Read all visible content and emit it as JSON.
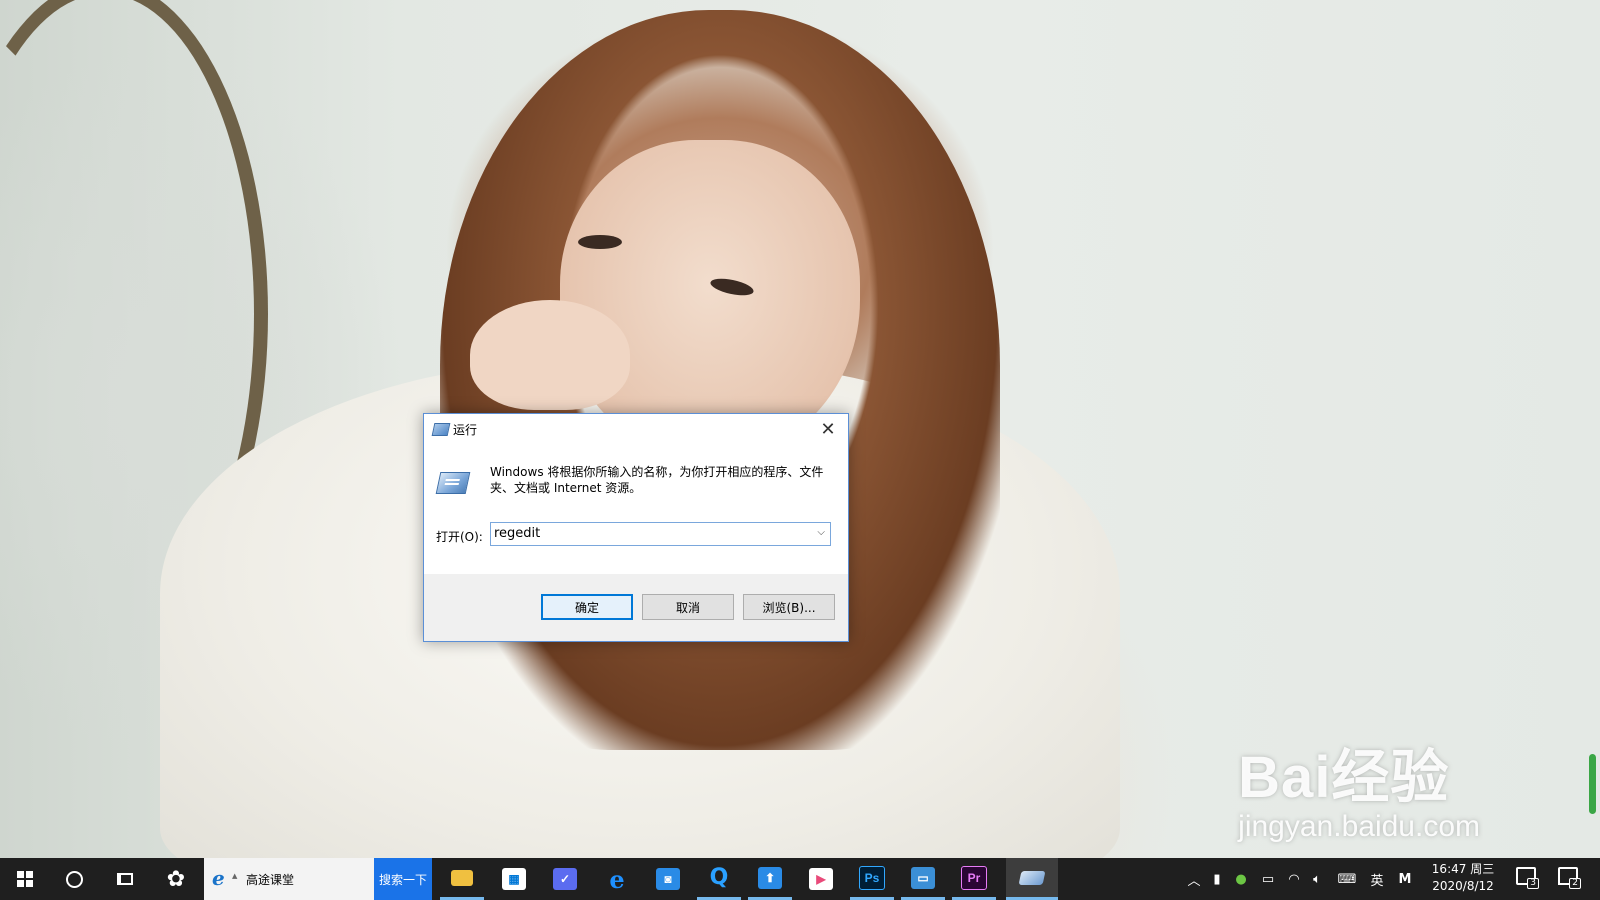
{
  "run_dialog": {
    "title": "运行",
    "description": "Windows 将根据你所输入的名称，为你打开相应的程序、文件夹、文档或 Internet 资源。",
    "open_label": "打开(O):",
    "command_value": "regedit",
    "ok_label": "确定",
    "cancel_label": "取消",
    "browse_label": "浏览(B)..."
  },
  "taskbar": {
    "search_text": "高途课堂",
    "search_button": "搜索一下",
    "apps": [
      {
        "name": "file-explorer",
        "color": "#f0c040"
      },
      {
        "name": "microsoft-store",
        "color": "#ffffff"
      },
      {
        "name": "app-feather",
        "color": "#5b6cf0"
      },
      {
        "name": "edge-browser",
        "color": "#1e90ff"
      },
      {
        "name": "app-lock",
        "color": "#2a8be6"
      },
      {
        "name": "browser-q",
        "color": "#2aa0ff"
      },
      {
        "name": "app-arrow",
        "color": "#2a8be6"
      },
      {
        "name": "app-media",
        "color": "#e94a7a"
      },
      {
        "name": "photoshop",
        "label": "Ps",
        "color": "#31a8ff"
      },
      {
        "name": "app-window",
        "color": "#3b8fd6"
      },
      {
        "name": "premiere",
        "label": "Pr",
        "color": "#e77cf7"
      },
      {
        "name": "run",
        "color": "#8fb6e0"
      }
    ],
    "tray": {
      "ime": "英",
      "ime_mode": "M",
      "time": "16:47 周三",
      "date": "2020/8/12",
      "action_center_count": "3",
      "notification_count": "2"
    }
  },
  "watermark": {
    "brand": "Bai经验",
    "url": "jingyan.baidu.com"
  }
}
